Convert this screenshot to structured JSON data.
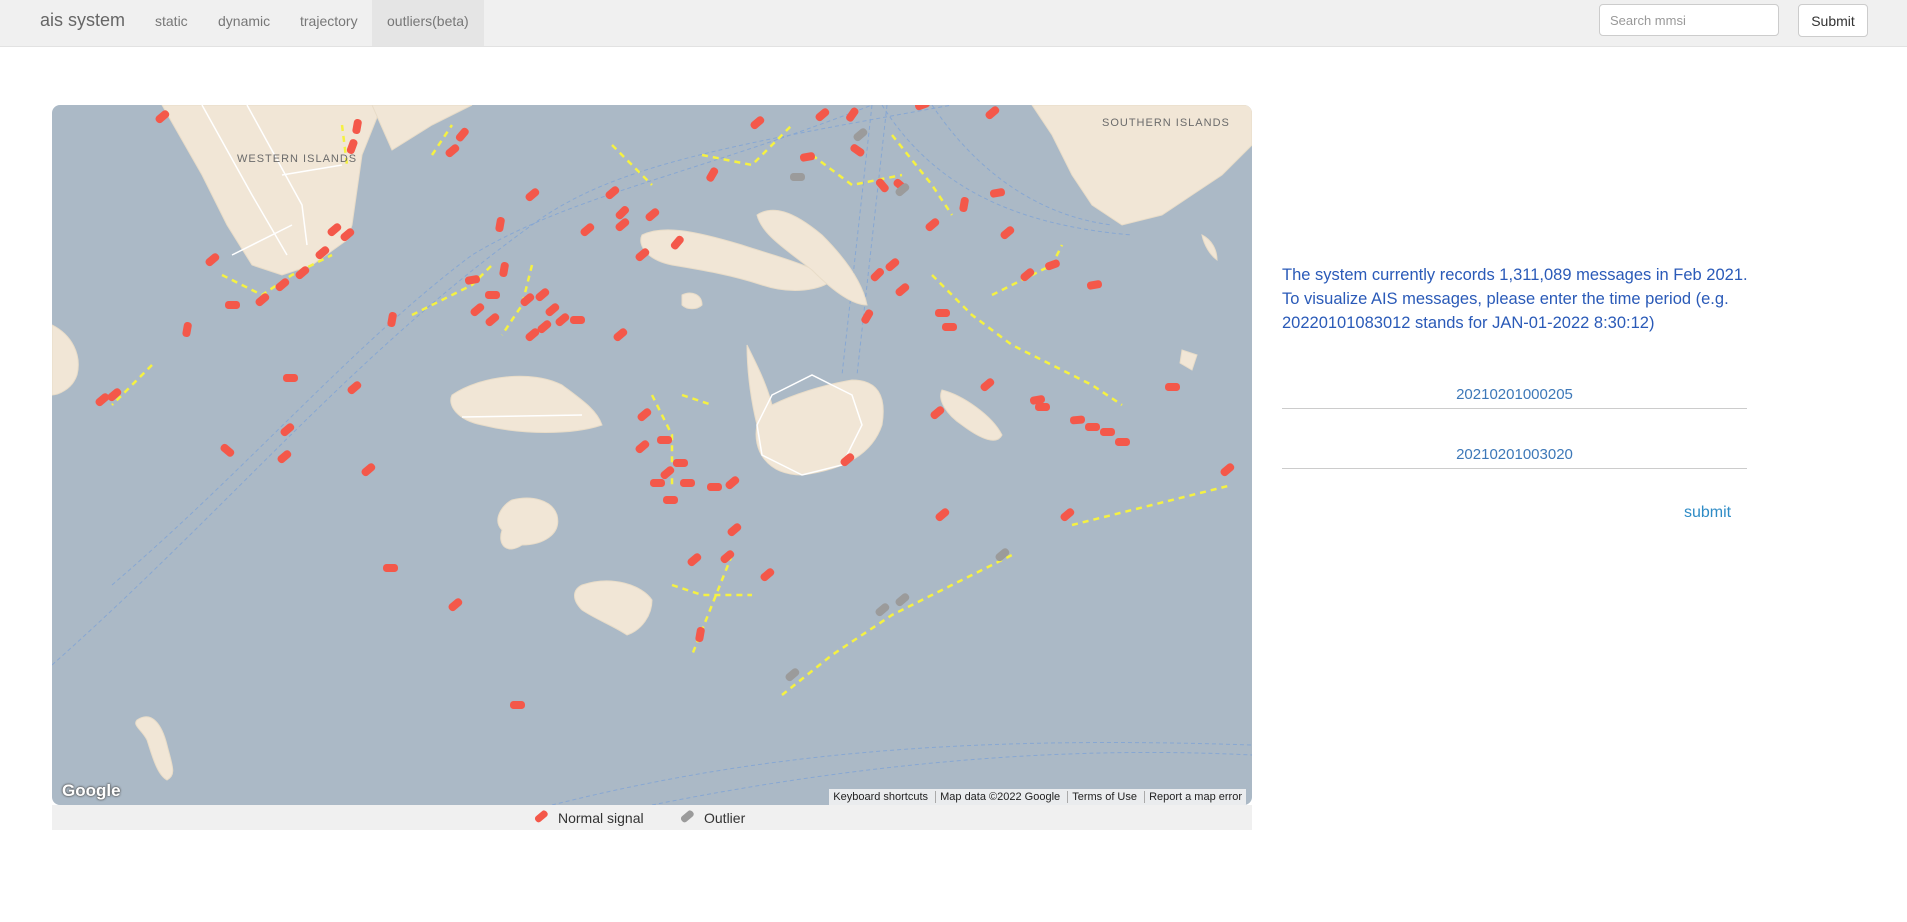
{
  "navbar": {
    "brand": "ais system",
    "items": [
      {
        "label": "static"
      },
      {
        "label": "dynamic"
      },
      {
        "label": "trajectory"
      },
      {
        "label": "outliers(beta)"
      }
    ],
    "search": {
      "placeholder": "Search mmsi",
      "value": ""
    },
    "submit_label": "Submit"
  },
  "map": {
    "labels": {
      "western_islands": "WESTERN ISLANDS",
      "southern_islands": "SOUTHERN ISLANDS"
    },
    "footer": {
      "keyboard": "Keyboard shortcuts",
      "map_data": "Map data ©2022 Google",
      "terms": "Terms of Use",
      "report": "Report a map error"
    },
    "logo": "Google"
  },
  "legend": {
    "normal": "Normal signal",
    "outlier": "Outlier",
    "normal_color": "#f4584a",
    "outlier_color": "#9b9b9b"
  },
  "info": {
    "line1": "The system currently records 1,311,089 messages in Feb 2021.",
    "line2": "To visualize AIS messages, please enter the time period (e.g. 20220101083012 stands for JAN-01-2022 8:30:12)"
  },
  "form": {
    "start_time": "20210201000205",
    "end_time": "20210201003020",
    "submit_label": "submit"
  },
  "colors": {
    "water": "#abb9c6",
    "land": "#f1e6d6",
    "trajectory": "#f5f142",
    "normal_vessel": "#f4584a",
    "outlier_vessel": "#9b9b9b"
  }
}
